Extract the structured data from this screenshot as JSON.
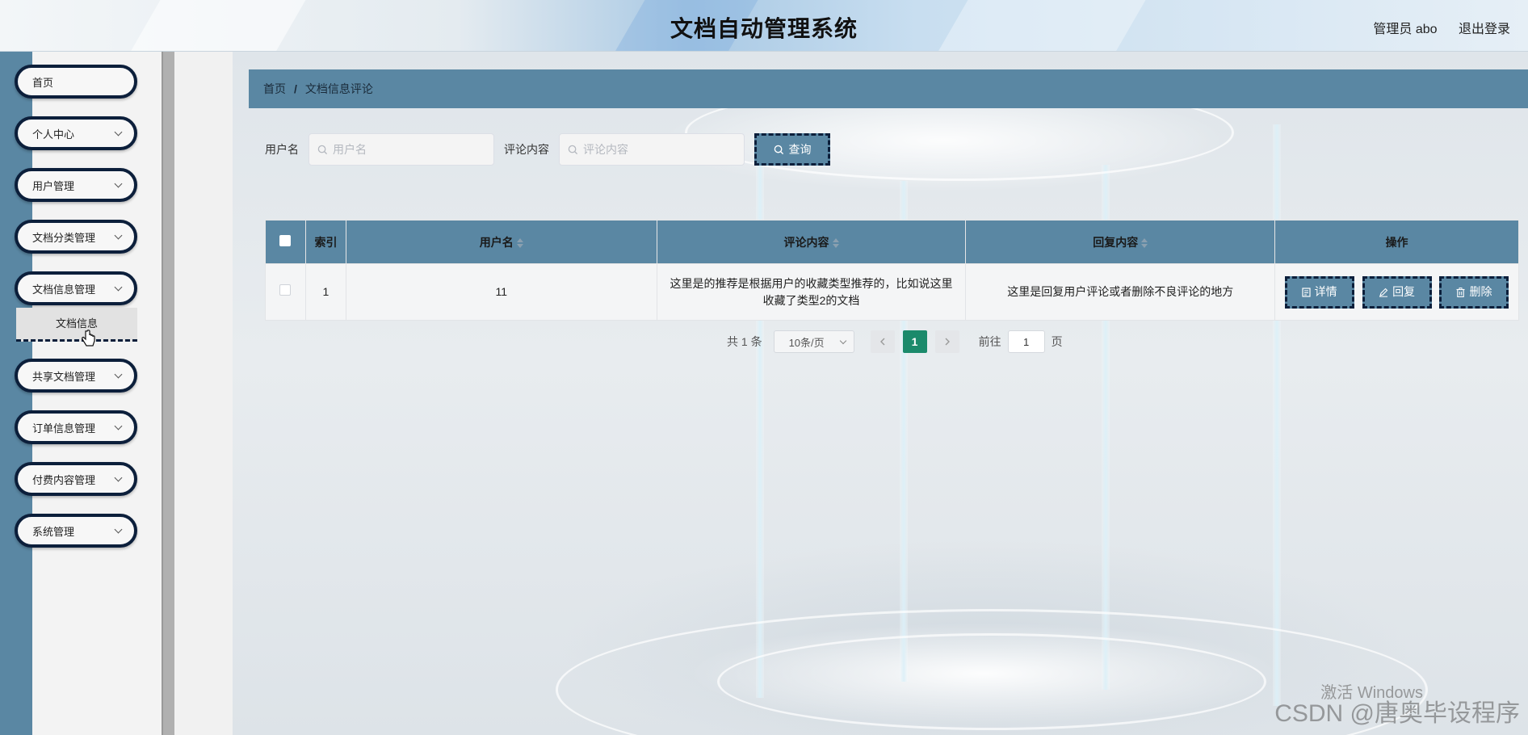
{
  "header": {
    "app_title": "文档自动管理系统",
    "user_label": "管理员 abo",
    "logout_label": "退出登录"
  },
  "sidebar": {
    "items": [
      {
        "label": "首页",
        "has_chevron": false
      },
      {
        "label": "个人中心",
        "has_chevron": true
      },
      {
        "label": "用户管理",
        "has_chevron": true
      },
      {
        "label": "文档分类管理",
        "has_chevron": true
      },
      {
        "label": "文档信息管理",
        "has_chevron": true
      },
      {
        "label": "共享文档管理",
        "has_chevron": true
      },
      {
        "label": "订单信息管理",
        "has_chevron": true
      },
      {
        "label": "付费内容管理",
        "has_chevron": true
      },
      {
        "label": "系统管理",
        "has_chevron": true
      }
    ],
    "active_submenu": "文档信息"
  },
  "breadcrumb": {
    "home": "首页",
    "separator": "/",
    "current": "文档信息评论"
  },
  "search": {
    "username_label": "用户名",
    "username_placeholder": "用户名",
    "username_value": "",
    "comment_label": "评论内容",
    "comment_placeholder": "评论内容",
    "comment_value": "",
    "query_button": "查询"
  },
  "table": {
    "headers": {
      "index": "索引",
      "username": "用户名",
      "comment": "评论内容",
      "reply": "回复内容",
      "actions": "操作"
    },
    "rows": [
      {
        "index": "1",
        "username": "11",
        "comment": "这里是的推荐是根据用户的收藏类型推荐的，比如说这里收藏了类型2的文档",
        "reply": "这里是回复用户评论或者删除不良评论的地方"
      }
    ],
    "actions": {
      "detail": "详情",
      "reply": "回复",
      "delete": "删除"
    }
  },
  "pagination": {
    "total": "共 1 条",
    "page_size": "10条/页",
    "current_page": "1",
    "goto_label": "前往",
    "goto_value": "1",
    "goto_suffix": "页"
  },
  "watermark": {
    "windows": "激活 Windows",
    "csdn": "CSDN @唐奥毕设程序"
  },
  "colors": {
    "accent": "#5a87a3",
    "border_dark": "#0c1f3b",
    "page_active": "#1b8a6b"
  }
}
